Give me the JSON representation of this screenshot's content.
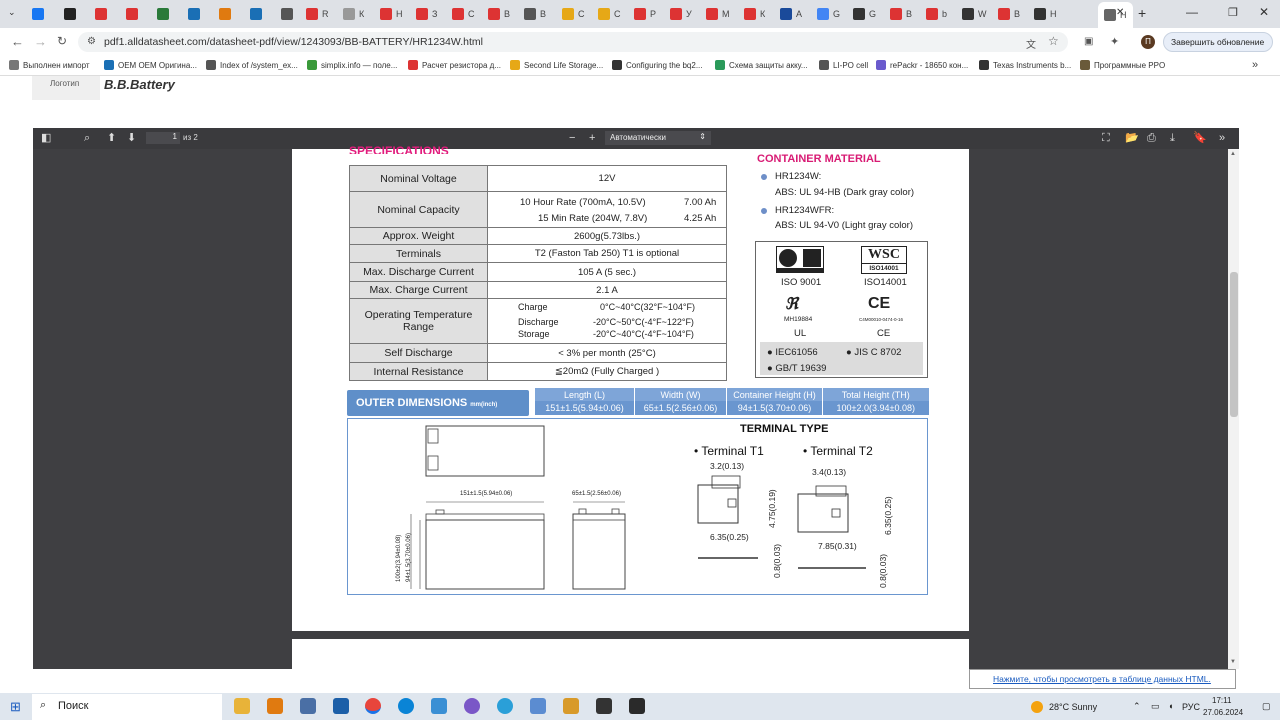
{
  "browser": {
    "tabs": [
      {
        "label": "R",
        "color": "#d33"
      },
      {
        "label": "К",
        "color": "#999"
      },
      {
        "label": "Н",
        "color": "#d33"
      },
      {
        "label": "З",
        "color": "#d33"
      },
      {
        "label": "С",
        "color": "#d33"
      },
      {
        "label": "В",
        "color": "#d33"
      },
      {
        "label": "В",
        "color": "#555"
      },
      {
        "label": "С",
        "color": "#e6a817"
      },
      {
        "label": "С",
        "color": "#e6a817"
      },
      {
        "label": "Р",
        "color": "#d33"
      },
      {
        "label": "У",
        "color": "#d33"
      },
      {
        "label": "М",
        "color": "#d33"
      },
      {
        "label": "К",
        "color": "#d33"
      },
      {
        "label": "А",
        "color": "#1a4a9a"
      },
      {
        "label": "G",
        "color": "#4285f4"
      },
      {
        "label": "G",
        "color": "#333"
      },
      {
        "label": "В",
        "color": "#d33"
      },
      {
        "label": "b",
        "color": "#d33"
      },
      {
        "label": "W",
        "color": "#333"
      },
      {
        "label": "В",
        "color": "#d33"
      },
      {
        "label": "Н",
        "color": "#333"
      }
    ],
    "active_tab": "Н",
    "url": "pdf1.alldatasheet.com/datasheet-pdf/view/1243093/BB-BATTERY/HR1234W.html",
    "update_button": "Завершить обновление",
    "profile_initial": "П",
    "bookmarks": [
      "Выполнен импорт",
      "OEM OEM Оригина...",
      "Index of /system_ex...",
      "simplix.info — поле...",
      "Расчет резистора д...",
      "Second Life Storage...",
      "Configuring the bq2...",
      "Схема защиты акку...",
      "LI-PO cell",
      "rePackr - 18650 кон...",
      "Texas Instruments b...",
      "Программные PPO"
    ]
  },
  "site": {
    "logo_label": "Логотип",
    "brand": "B.B.Battery"
  },
  "pdf_toolbar": {
    "page_input": "1",
    "page_total": "из 2",
    "zoom": "Автоматически"
  },
  "spec": {
    "title": "SPECIFICATIONS",
    "rows": [
      {
        "label": "Nominal Voltage",
        "value": "12V"
      },
      {
        "label": "Nominal Capacity",
        "r1": "10 Hour Rate (700mA, 10.5V)",
        "v1": "7.00 Ah",
        "r2": "15 Min Rate (204W, 7.8V)",
        "v2": "4.25 Ah"
      },
      {
        "label": "Approx. Weight",
        "value": "2600g(5.73lbs.)"
      },
      {
        "label": "Terminals",
        "value": "T2 (Faston Tab 250) T1 is optional"
      },
      {
        "label": "Max. Discharge Current",
        "value": "105 A (5 sec.)"
      },
      {
        "label": "Max. Charge Current",
        "value": "2.1 A"
      },
      {
        "label": "Operating Temperature Range",
        "c": "Charge",
        "cv": "0°C~40°C(32°F~104°F)",
        "d": "Discharge",
        "dv": "-20°C~50°C(-4°F~122°F)",
        "s": "Storage",
        "sv": "-20°C~40°C(-4°F~104°F)"
      },
      {
        "label": "Self Discharge",
        "value": "< 3% per month (25°C)"
      },
      {
        "label": "Internal Resistance",
        "value": "≦20mΩ (Fully Charged )"
      }
    ]
  },
  "container": {
    "title": "CONTAINER MATERIAL",
    "item1_name": "HR1234W:",
    "item1_mat": "ABS: UL 94-HB  (Dark gray color)",
    "item2_name": "HR1234WFR:",
    "item2_mat": "ABS: UL 94-V0  (Light gray color)"
  },
  "certs": {
    "iso9001": "ISO 9001",
    "iso14001": "ISO14001",
    "wsc": "WSC",
    "wsc_sub": "ISO14001",
    "ul_num": "MH19884",
    "ul": "UL",
    "ce_num": "C4M00010-0474-0-16",
    "ce": "CE",
    "iec": "IEC61056",
    "jis": "JIS C  8702",
    "gbt": "GB/T 19639"
  },
  "dimensions": {
    "title": "OUTER DIMENSIONS",
    "unit": "mm(inch)",
    "headers": [
      "Length (L)",
      "Width (W)",
      "Container Height (H)",
      "Total Height (TH)"
    ],
    "values": [
      "151±1.5(5.94±0.06)",
      "65±1.5(2.56±0.06)",
      "94±1.5(3.70±0.06)",
      "100±2.0(3.94±0.08)"
    ]
  },
  "terminal": {
    "title": "TERMINAL TYPE",
    "t1": "Terminal T1",
    "t2": "Terminal T2",
    "t1_w": "3.2(0.13)",
    "t1_h": "4.75(0.19)",
    "t1_b": "6.35(0.25)",
    "t1_t": "0.8(0.03)",
    "t2_w": "3.4(0.13)",
    "t2_h": "6.35(0.25)",
    "t2_b": "7.85(0.31)",
    "t2_t": "0.8(0.03)"
  },
  "drawing": {
    "len": "151±1.5(5.94±0.06)",
    "wid": "65±1.5(2.56±0.06)",
    "th": "100±2(3.94±0.08)",
    "h": "94±1.5(3.70±0.06)"
  },
  "status_link": "Нажмите, чтобы просмотреть в таблице данных HTML.",
  "taskbar": {
    "search": "Поиск",
    "weather": "28°C  Sunny",
    "lang": "РУС",
    "time": "17:11",
    "date": "27.06.2024"
  }
}
